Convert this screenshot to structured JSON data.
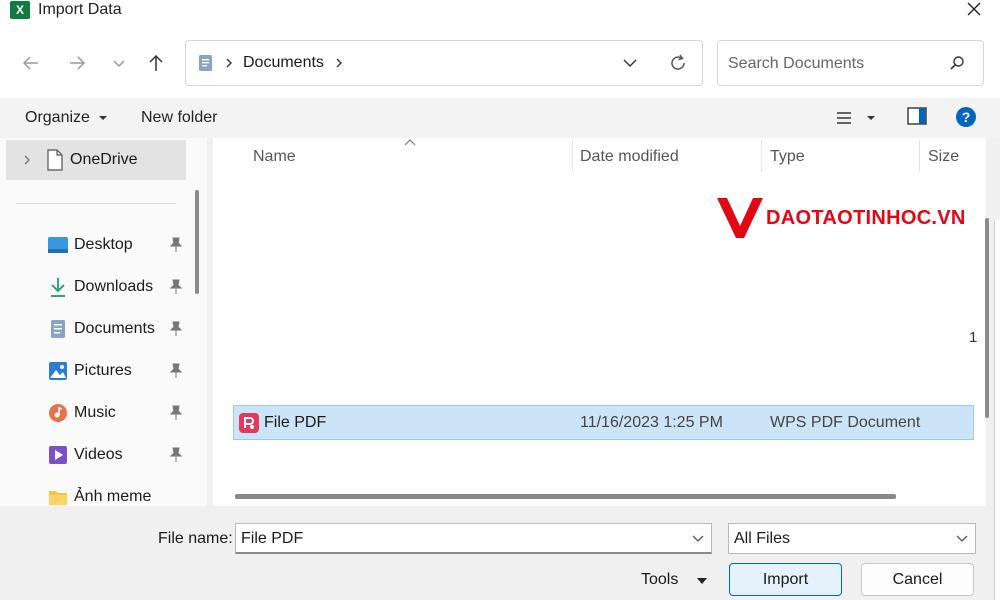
{
  "window": {
    "title": "Import Data",
    "app_icon": "excel-icon",
    "app_icon_letter": "X"
  },
  "nav": {
    "breadcrumb": [
      "Documents"
    ],
    "search_placeholder": "Search Documents"
  },
  "toolbar": {
    "organize_label": "Organize",
    "new_folder_label": "New folder"
  },
  "sidebar": {
    "items": [
      {
        "label": "OneDrive",
        "icon": "document-icon"
      },
      {
        "label": "Desktop",
        "icon": "desktop-icon"
      },
      {
        "label": "Downloads",
        "icon": "download-icon"
      },
      {
        "label": "Documents",
        "icon": "documents-icon"
      },
      {
        "label": "Pictures",
        "icon": "pictures-icon"
      },
      {
        "label": "Music",
        "icon": "music-icon"
      },
      {
        "label": "Videos",
        "icon": "videos-icon"
      },
      {
        "label": "Ảnh meme",
        "icon": "folder-icon"
      }
    ]
  },
  "filelist": {
    "columns": [
      "Name",
      "Date modified",
      "Type",
      "Size"
    ],
    "rows": [
      {
        "name": "File PDF",
        "date": "11/16/2023 1:25 PM",
        "type": "WPS PDF Document",
        "selected": true
      }
    ],
    "watermark": "DAOTAOTINHOC.VN",
    "stray_text": "1"
  },
  "bottom": {
    "file_name_label": "File name:",
    "file_name_value": "File PDF",
    "filter_value": "All Files",
    "tools_label": "Tools",
    "import_label": "Import",
    "cancel_label": "Cancel"
  },
  "colors": {
    "accent": "#0067c0",
    "selection": "#cce4f7",
    "excel_green": "#107c41",
    "watermark_red": "#e30613"
  }
}
